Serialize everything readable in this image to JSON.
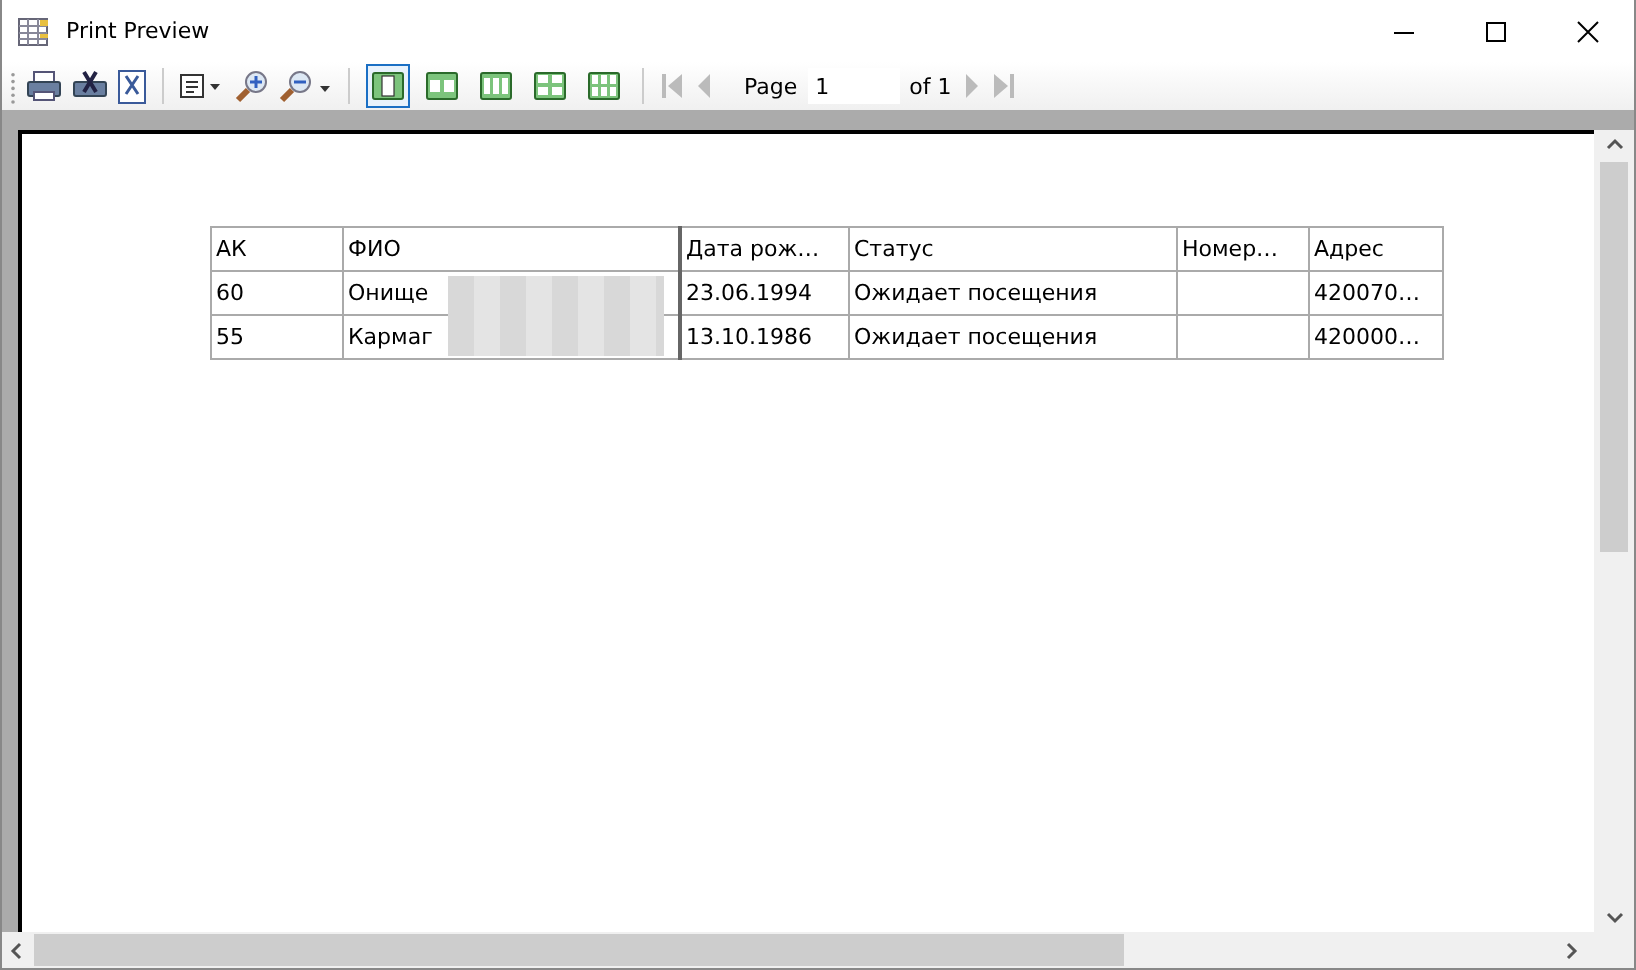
{
  "window": {
    "title": "Print Preview"
  },
  "toolbar": {
    "tools": [
      {
        "kind": "print"
      },
      {
        "kind": "print-setup"
      },
      {
        "kind": "page-setup"
      },
      {
        "kind": "sep"
      },
      {
        "kind": "view-menu"
      },
      {
        "kind": "zoom-in"
      },
      {
        "kind": "zoom-out"
      },
      {
        "kind": "sep"
      }
    ],
    "layouts": [
      {
        "kind": "one",
        "selected": true
      },
      {
        "kind": "two",
        "selected": false
      },
      {
        "kind": "three",
        "selected": false
      },
      {
        "kind": "four",
        "selected": false
      },
      {
        "kind": "six",
        "selected": false
      }
    ],
    "page_label": "Page",
    "page_value": "1",
    "page_of": "of 1"
  },
  "table": {
    "columns": [
      "АК",
      "ФИО",
      "Дата рож…",
      "Статус",
      "Номер…",
      "Адрес"
    ],
    "rows": [
      {
        "cells": [
          "60",
          "Онище",
          "23.06.1994",
          "Ожидает посещения",
          "",
          "420070…"
        ]
      },
      {
        "cells": [
          "55",
          "Кармаг",
          "13.10.1986",
          "Ожидает посещения",
          "",
          "420000…"
        ]
      }
    ]
  }
}
